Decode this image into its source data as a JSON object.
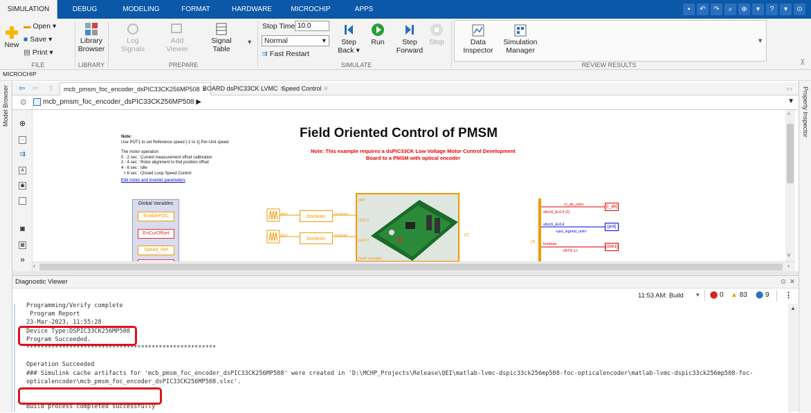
{
  "tabs": [
    "SIMULATION",
    "DEBUG",
    "MODELING",
    "FORMAT",
    "HARDWARE",
    "MICROCHIP",
    "APPS"
  ],
  "ribbon": {
    "file": {
      "new": "New",
      "open": "Open",
      "save": "Save",
      "print": "Print",
      "group": "FILE"
    },
    "library": {
      "label_1": "Library",
      "label_2": "Browser",
      "group": "LIBRARY"
    },
    "prepare": {
      "log_1": "Log",
      "log_2": "Signals",
      "add_1": "Add",
      "add_2": "Viewer",
      "sigtable_1": "Signal",
      "sigtable_2": "Table",
      "group": "PREPARE"
    },
    "simulate": {
      "stop_time_label": "Stop Time",
      "stop_time_value": "10.0",
      "mode": "Normal",
      "fast_restart": "Fast Restart",
      "step_back_1": "Step",
      "step_back_2": "Back",
      "run": "Run",
      "step_fwd_1": "Step",
      "step_fwd_2": "Forward",
      "stop": "Stop",
      "group": "SIMULATE"
    },
    "review": {
      "data_1": "Data",
      "data_2": "Inspector",
      "sim_1": "Simulation",
      "sim_2": "Manager",
      "group": "REVIEW RESULTS"
    }
  },
  "toolstrip_label": "MICROCHIP",
  "side": {
    "model_browser": "Model Browser",
    "property_inspector": "Property Inspector"
  },
  "editor_tabs": [
    "mcb_pmsm_foc_encoder_dsPIC33CK256MP508",
    "BOARD dsPIC33CK LVMC",
    "Speed Control"
  ],
  "address": "mcb_pmsm_foc_encoder_dsPIC33CK256MP508",
  "model": {
    "title": "Field Oriented Control of PMSM",
    "note_red": "Note: This example requires a dsPIC33CK Low Voltage Motor Control Development Board to a PMSM with optical encoder",
    "note_title": "Note:",
    "note_lines": [
      "Use POT1 to set Reference speed [-1 to 1] Per-Unit speed",
      "",
      "The motor operation",
      "0 - 2 sec : Current measurement offset calibration",
      "2 - 4 sec : Rotor alignment to find position offset",
      "4 - 6 sec : Idle",
      "  > 6 sec : Closed Loop Speed Control"
    ],
    "link": "Edit motor and inverter parameters",
    "global_vars_title": "Global Variables",
    "global_vars": [
      "EnableFOC",
      "EnCurOffset",
      "Speed_Ref",
      ""
    ],
    "blocks": {
      "sfix1": "sfix1",
      "boolean": "boolean",
      "init": "INIT",
      "led1": "LED 1",
      "led2": "LED 2",
      "reset": "reset encoder",
      "bus_in": "[2]",
      "bus_out": "[3]"
    },
    "sigs": [
      "<I_ab_unit>",
      "sfix16_En14 (2)",
      "sfix16_En14",
      "<pol_signed_unit>",
      "boolean",
      "<BTN 1>"
    ],
    "tags": [
      "[I_ab]",
      "[pol]",
      "[SW1]"
    ]
  },
  "diagnostic": {
    "title": "Diagnostic Viewer",
    "build_label": "11:53 AM: Build",
    "errors": "0",
    "warnings": "83",
    "infos": "9",
    "lines": [
      "Programming/Verify complete",
      " Program Report",
      "23-Mar-2023, 11:55:28",
      "Device Type:DSPIC33CK256MP508",
      "Program Succeeded.",
      "*****************************************************",
      "",
      "Operation Succeeded",
      "### Simulink cache artifacts for 'mcb_pmsm_foc_encoder_dsPIC33CK256MP508' were created in 'D:\\MCHP_Projects\\Release\\QEI\\matlab-lvmc-dspic33ck256mp508-foc-opticalencoder\\matlab-lvmc-dspic33ck256mp508-foc-",
      "opticalencoder\\mcb_pmsm_foc_encoder_dsPIC33CK256MP508.slxc'.",
      "",
      "",
      "Build process completed successfully"
    ]
  },
  "colors": {
    "tabbar": "#0b57a8",
    "accent": "#f39800",
    "highlight": "#e0101a"
  }
}
